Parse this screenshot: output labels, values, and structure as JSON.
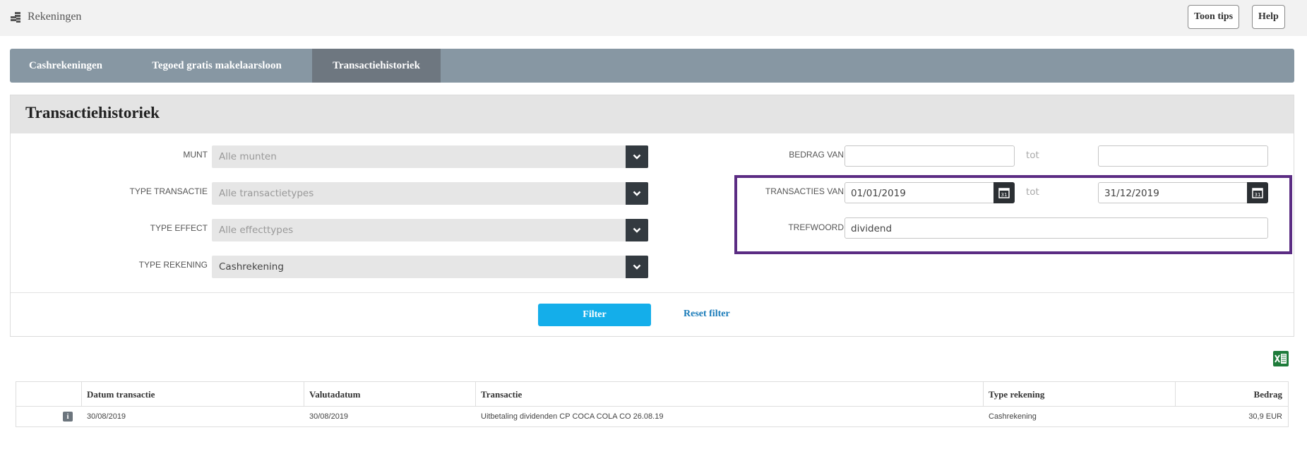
{
  "header": {
    "app_icon": "coins-icon",
    "title": "Rekeningen",
    "tips_label": "Toon tips",
    "help_label": "Help"
  },
  "tabs": [
    {
      "label": "Cashrekeningen",
      "active": false
    },
    {
      "label": "Tegoed gratis makelaarsloon",
      "active": false
    },
    {
      "label": "Transactiehistoriek",
      "active": true
    }
  ],
  "panel": {
    "title": "Transactiehistoriek",
    "munt": {
      "label": "MUNT",
      "value": "Alle munten",
      "is_placeholder": true
    },
    "type_transactie": {
      "label": "TYPE TRANSACTIE",
      "value": "Alle transactietypes",
      "is_placeholder": true
    },
    "type_effect": {
      "label": "TYPE EFFECT",
      "value": "Alle effecttypes",
      "is_placeholder": true
    },
    "type_rekening": {
      "label": "TYPE REKENING",
      "value": "Cashrekening",
      "is_placeholder": false
    },
    "bedrag": {
      "label": "BEDRAG VAN",
      "from": "",
      "to_label": "tot",
      "to": ""
    },
    "transacties": {
      "label": "TRANSACTIES VAN",
      "from": "01/01/2019",
      "to_label": "tot",
      "to": "31/12/2019",
      "calendar_icon": "calendar-icon"
    },
    "trefwoord": {
      "label": "TREFWOORD",
      "value": "dividend"
    },
    "filter_label": "Filter",
    "reset_label": "Reset filter"
  },
  "export": {
    "icon": "excel-icon"
  },
  "table": {
    "headers": [
      "",
      "Datum transactie",
      "Valutadatum",
      "Transactie",
      "Type rekening",
      "Bedrag"
    ],
    "rows": [
      {
        "icon": "info-icon",
        "datum": "30/08/2019",
        "valuta": "30/08/2019",
        "transactie": "Uitbetaling dividenden CP COCA COLA CO 26.08.19",
        "type": "Cashrekening",
        "bedrag": "30,9 EUR"
      }
    ]
  },
  "colors": {
    "tabbar": "#8797a3",
    "tab_active": "#6e7780",
    "filter_button": "#14aeea",
    "highlight_box": "#5b2c83"
  }
}
